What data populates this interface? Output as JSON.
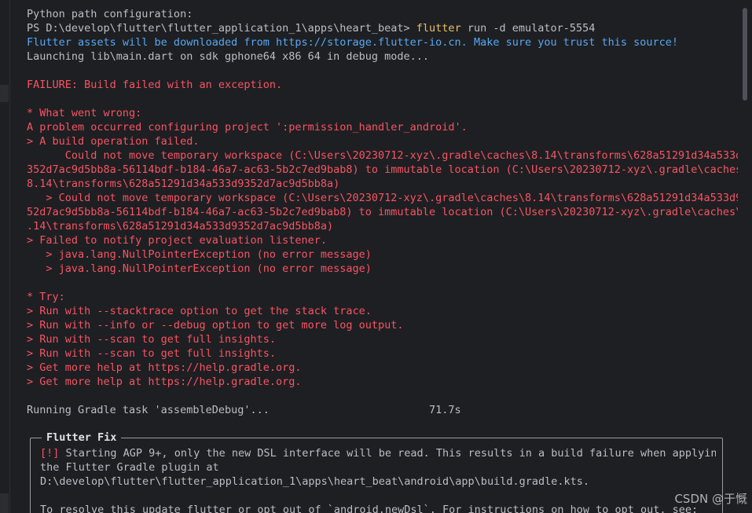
{
  "terminal": {
    "lines": [
      {
        "text": "Python path configuration:",
        "color": "white"
      },
      {
        "prefix": "PS D:\\develop\\flutter\\flutter_application_1\\apps\\heart_beat> ",
        "command": "flutter",
        "args": " run -d emulator-5554"
      },
      {
        "text": "Flutter assets will be downloaded from https://storage.flutter-io.cn. Make sure you trust this source!",
        "color": "blue"
      },
      {
        "text": "Launching lib\\main.dart on sdk gphone64 x86 64 in debug mode...",
        "color": "white"
      },
      {
        "text": "",
        "color": "white"
      },
      {
        "text": "FAILURE: Build failed with an exception.",
        "color": "red"
      },
      {
        "text": "",
        "color": "white"
      },
      {
        "text": "* What went wrong:",
        "color": "red"
      },
      {
        "text": "A problem occurred configuring project ':permission_handler_android'.",
        "color": "red"
      },
      {
        "text": "> A build operation failed.",
        "color": "red"
      },
      {
        "text": "      Could not move temporary workspace (C:\\Users\\20230712-xyz\\.gradle\\caches\\8.14\\transforms\\628a51291d34a533d9",
        "color": "red"
      },
      {
        "text": "352d7ac9d5bb8a-56114bdf-b184-46a7-ac63-5b2c7ed9bab8) to immutable location (C:\\Users\\20230712-xyz\\.gradle\\caches\\",
        "color": "red"
      },
      {
        "text": "8.14\\transforms\\628a51291d34a533d9352d7ac9d5bb8a)",
        "color": "red"
      },
      {
        "text": "   > Could not move temporary workspace (C:\\Users\\20230712-xyz\\.gradle\\caches\\8.14\\transforms\\628a51291d34a533d93",
        "color": "red"
      },
      {
        "text": "52d7ac9d5bb8a-56114bdf-b184-46a7-ac63-5b2c7ed9bab8) to immutable location (C:\\Users\\20230712-xyz\\.gradle\\caches\\8",
        "color": "red"
      },
      {
        "text": ".14\\transforms\\628a51291d34a533d9352d7ac9d5bb8a)",
        "color": "red"
      },
      {
        "text": "> Failed to notify project evaluation listener.",
        "color": "red"
      },
      {
        "text": "   > java.lang.NullPointerException (no error message)",
        "color": "red"
      },
      {
        "text": "   > java.lang.NullPointerException (no error message)",
        "color": "red"
      },
      {
        "text": "",
        "color": "white"
      },
      {
        "text": "* Try:",
        "color": "red"
      },
      {
        "text": "> Run with --stacktrace option to get the stack trace.",
        "color": "red"
      },
      {
        "text": "> Run with --info or --debug option to get more log output.",
        "color": "red"
      },
      {
        "text": "> Run with --scan to get full insights.",
        "color": "red"
      },
      {
        "text": "> Run with --scan to get full insights.",
        "color": "red"
      },
      {
        "text": "> Get more help at https://help.gradle.org.",
        "color": "red"
      },
      {
        "text": "> Get more help at https://help.gradle.org.",
        "color": "red"
      },
      {
        "text": "",
        "color": "white"
      },
      {
        "text": "Running Gradle task 'assembleDebug'...                         71.7s",
        "color": "white"
      }
    ]
  },
  "flutter_fix": {
    "title": "Flutter Fix",
    "tag": "[!]",
    "line1_rest": " Starting AGP 9+, only the new DSL interface will be read. This results in a build failure when applying",
    "line2": "the Flutter Gradle plugin at",
    "line3": "D:\\develop\\flutter\\flutter_application_1\\apps\\heart_beat\\android\\app\\build.gradle.kts.",
    "line4": "",
    "line5": "To resolve this update flutter or opt out of `android.newDsl`. For instructions on how to opt out, see:"
  },
  "watermark": "CSDN @于慨",
  "colors": {
    "background": "#1e1f22",
    "text": "#bcbec4",
    "error": "#f75464",
    "info": "#56a8f5",
    "command": "#e6c16a"
  }
}
